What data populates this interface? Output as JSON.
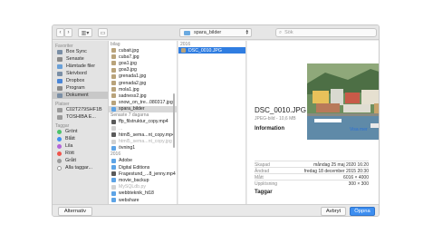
{
  "toolbar": {
    "back_icon": "chevron-left-icon",
    "forward_icon": "chevron-right-icon",
    "view_icon": "column-view-icon",
    "new_folder_icon": "folder-icon",
    "path": "spara_bilder",
    "search_placeholder": "Sök"
  },
  "sidebar": {
    "favorites_header": "Favoriter",
    "favorites": [
      "Box Sync",
      "Senaste",
      "Hämtade filer",
      "Skrivbord",
      "Dropbox",
      "Program",
      "Dokument"
    ],
    "places_header": "Platser",
    "places": [
      "C02T279SHF1B",
      "TOSHIBA E..."
    ],
    "tags_header": "Taggar",
    "tags": [
      {
        "label": "Grönt",
        "color": "#4cc36b"
      },
      {
        "label": "Blått",
        "color": "#3f8ef0"
      },
      {
        "label": "Lila",
        "color": "#b264d8"
      },
      {
        "label": "Rött",
        "color": "#f0544c"
      },
      {
        "label": "Grått",
        "color": "#9b9b9b"
      },
      {
        "label": "Alla taggar...",
        "color": "#ffffff"
      }
    ]
  },
  "column1": {
    "top_label": "bilag",
    "files": [
      "cubait.jpg",
      "cuba7.jpg",
      "goa1.jpg",
      "goa3.jpg",
      "grenada1.jpg",
      "grenada2.jpg",
      "mola1.jpg",
      "sadness2.jpg",
      "snow_on_tre...080317.jpg",
      "spara_bilder"
    ],
    "section2": "Senaste 7 dagarna",
    "files2": [
      "ffp_filstruktur_copy.mp4",
      "...",
      "html5_sema...nt_copy.mp4",
      "html5_sema...nt_copy.jpg",
      "övning1"
    ],
    "section3": "2016",
    "files3": [
      "Adobe",
      "Digital Editions",
      "Fragestund_...8_jenny.mp4",
      "movie_backup",
      "MySQLdb.py",
      "webbteknik_ht18",
      "webshare"
    ]
  },
  "column2": {
    "section": "2016",
    "files": [
      "DSC_0010.JPG"
    ]
  },
  "preview": {
    "title": "DSC_0010.JPG",
    "subtitle": "JPEG-bild - 10,6 MB",
    "info_label": "Information",
    "show_more": "Visa mer",
    "rows": [
      {
        "label": "Skapad",
        "value": "måndag 25 maj 2020 16:20"
      },
      {
        "label": "Ändrad",
        "value": "fredag 18 december 2015 20:30"
      },
      {
        "label": "Mått",
        "value": "6016 × 4000"
      },
      {
        "label": "Upplösning",
        "value": "300 × 300"
      }
    ],
    "tags_label": "Taggar"
  },
  "bottom": {
    "options": "Alternativ",
    "cancel": "Avbryt",
    "open": "Öppna"
  },
  "colors": {
    "accent": "#3d8ef0",
    "selected_row": "#2f7de1"
  }
}
